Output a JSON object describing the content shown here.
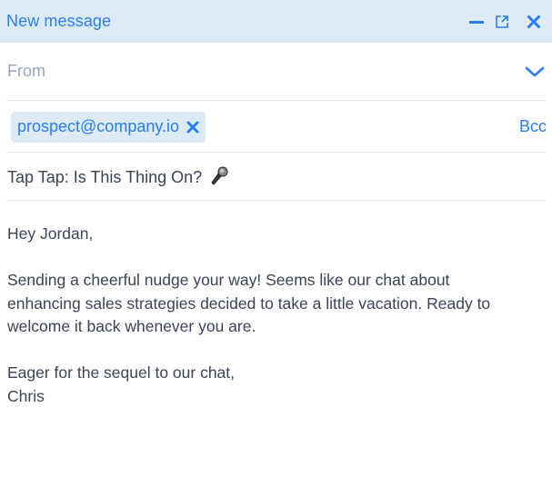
{
  "header": {
    "title": "New message",
    "actions": [
      {
        "name": "minimize-icon",
        "label": "Minimize"
      },
      {
        "name": "popout-icon",
        "label": "Pop out"
      },
      {
        "name": "close-icon",
        "label": "Close"
      }
    ]
  },
  "from": {
    "placeholder": "From",
    "dropdown_icon": "chevron-down-icon"
  },
  "to": {
    "recipients": [
      {
        "email": "prospect@company.io",
        "remove_icon": "close-icon"
      }
    ],
    "bcc_label": "Bcc"
  },
  "subject": {
    "text": "Tap Tap: Is This Thing On?",
    "emoji": "microphone-icon"
  },
  "body": {
    "greeting": "Hey Jordan,",
    "paragraph_lines": [
      "Sending a cheerful nudge your way! Seems like our chat about",
      "enhancing sales strategies decided to take a little vacation. Ready to",
      "welcome it back whenever you are."
    ],
    "closing": "Eager for the sequel to our chat,",
    "signature": "Chris"
  },
  "colors": {
    "accent": "#2b7de9",
    "header_bg": "#dbeaf5",
    "text": "#3b4356",
    "muted": "#98a5bd",
    "divider": "#e3e6ef"
  }
}
